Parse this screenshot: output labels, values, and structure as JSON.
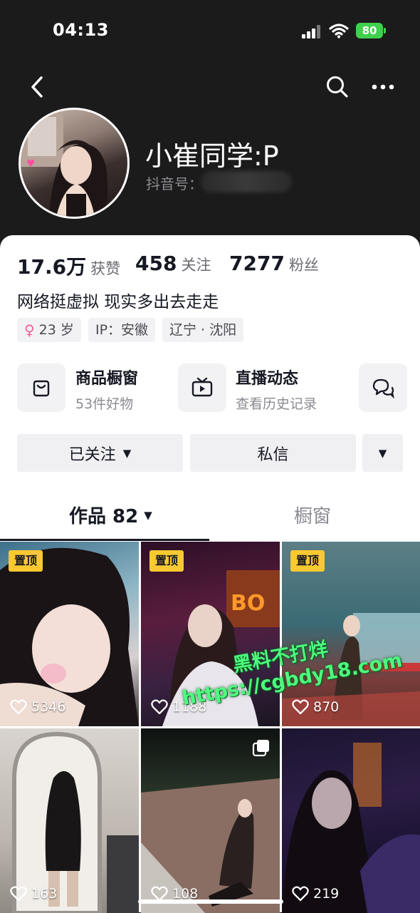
{
  "status_bar": {
    "time": "04:13",
    "battery": "80"
  },
  "profile": {
    "nickname": "小崔同学:P",
    "douyin_id_label": "抖音号：",
    "stats": [
      {
        "value": "17.6万",
        "label": "获赞"
      },
      {
        "value": "458",
        "label": "关注"
      },
      {
        "value": "7277",
        "label": "粉丝"
      }
    ],
    "bio": "网络挺虚拟 现实多出去走走",
    "tags": {
      "age": "23 岁",
      "ip": "IP：安徽",
      "location": "辽宁 · 沈阳"
    }
  },
  "entries": [
    {
      "title": "商品橱窗",
      "subtitle": "53件好物",
      "icon": "shopping-bag-icon"
    },
    {
      "title": "直播动态",
      "subtitle": "查看历史记录",
      "icon": "tv-icon"
    },
    {
      "title": "",
      "subtitle": "",
      "icon": "chat-bubbles-icon"
    }
  ],
  "actions": {
    "followed": "已关注",
    "message": "私信"
  },
  "tabs": {
    "works": "作品 82",
    "showcase": "橱窗"
  },
  "videos": [
    {
      "pinned": "置顶",
      "likes": "5346"
    },
    {
      "pinned": "置顶",
      "likes": "1188"
    },
    {
      "pinned": "置顶",
      "likes": "870"
    },
    {
      "pinned": "",
      "likes": "163"
    },
    {
      "pinned": "",
      "likes": "108"
    },
    {
      "pinned": "",
      "likes": "219"
    }
  ],
  "watermark": {
    "line1": "黑料不打烊",
    "line2": "https://cgbdy18.com"
  },
  "colors": {
    "pin": "#f9c932",
    "watermark": "#4dfc7e",
    "battery": "#3fd04d"
  }
}
